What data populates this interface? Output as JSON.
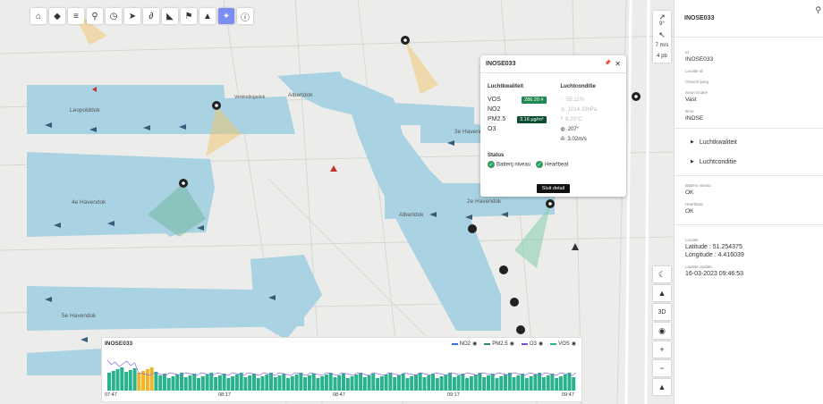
{
  "toolbar": {
    "buttons": [
      {
        "name": "home-icon",
        "glyph": "⌂"
      },
      {
        "name": "layers-icon",
        "glyph": "◆"
      },
      {
        "name": "filter-icon",
        "glyph": "≡"
      },
      {
        "name": "search-icon",
        "glyph": "⚲"
      },
      {
        "name": "clock-icon",
        "glyph": "◷"
      },
      {
        "name": "cursor-icon",
        "glyph": "➤"
      },
      {
        "name": "route-icon",
        "glyph": "∂"
      },
      {
        "name": "tag-icon",
        "glyph": "◣"
      },
      {
        "name": "flag-icon",
        "glyph": "⚑"
      },
      {
        "name": "warning-icon",
        "glyph": "▲"
      },
      {
        "name": "sensor-icon",
        "glyph": "✦",
        "active": true
      },
      {
        "name": "info-icon",
        "glyph": "ⓘ"
      }
    ]
  },
  "wind": {
    "rows": [
      {
        "arrow": "↗",
        "value": "9°"
      },
      {
        "arrow": "↖",
        "value": ""
      },
      {
        "arrow": "",
        "value": "7 m/s"
      },
      {
        "arrow": "",
        "value": "4 pb"
      }
    ]
  },
  "map_controls": [
    {
      "name": "night-mode-icon",
      "glyph": "☾"
    },
    {
      "name": "terrain-icon",
      "glyph": "▲"
    },
    {
      "name": "3d-button",
      "glyph": "3D"
    },
    {
      "name": "locate-icon",
      "glyph": "◉"
    },
    {
      "name": "zoom-in-button",
      "glyph": "+"
    },
    {
      "name": "zoom-out-button",
      "glyph": "−"
    },
    {
      "name": "compass-icon",
      "glyph": "▲"
    }
  ],
  "map_labels": {
    "leopolddok": "Leopolddok",
    "albertdok_top": "Albertdok",
    "havendok_4e": "4e Havendok",
    "albertdok_mid": "Albertdok",
    "havendok_3e": "3e Havendok",
    "havendok_5e": "5e Havendok",
    "havendok_2e": "2e Havendok",
    "verbindingsdok": "Verbindingsdok"
  },
  "popup": {
    "title": "INOSE033",
    "pin_icon": "📌",
    "close_icon": "✕",
    "air_heading": "Luchtkwaliteit",
    "air_rows": [
      {
        "label": "VOS",
        "value": "286.20 #",
        "dark": false
      },
      {
        "label": "NO2",
        "value": "",
        "dark": false
      },
      {
        "label": "PM2.5",
        "value": "3.16 µg/m³",
        "dark": true
      },
      {
        "label": "O3",
        "value": "",
        "dark": false
      }
    ],
    "cond_heading": "Luchtconditie",
    "cond_rows": [
      {
        "icon": "◌",
        "value": "55.11%",
        "faded": true
      },
      {
        "icon": "◎",
        "value": "1014.33hPa",
        "faded": true
      },
      {
        "icon": "⫯",
        "value": "8.20°C",
        "faded": true
      },
      {
        "icon": "◍",
        "value": "207°",
        "faded": false
      },
      {
        "icon": "✇",
        "value": "3.02m/s",
        "faded": false
      }
    ],
    "status_heading": "Status",
    "status_items": [
      "Batterij niveau",
      "Heartbeat"
    ],
    "close_label": "Sluit detail"
  },
  "timeline": {
    "title": "INOSE033",
    "legend": [
      {
        "label": "NO2",
        "color": "#3a6bd8"
      },
      {
        "label": "PM2.5",
        "color": "#2e8b57"
      },
      {
        "label": "O3",
        "color": "#7d4fc4"
      },
      {
        "label": "VOS",
        "color": "#2ab28f"
      }
    ],
    "ticks": [
      "07:47",
      "08:17",
      "08:47",
      "09:17",
      "09:47"
    ]
  },
  "panel": {
    "title": "INOSE033",
    "search_icon": "⚲",
    "fields": [
      {
        "label": "Id",
        "value": "INOSE033"
      },
      {
        "label": "Locatie Id",
        "value": ""
      },
      {
        "label": "Omschrijving",
        "value": ""
      },
      {
        "label": "Soort locatie",
        "value": "Vast"
      },
      {
        "label": "Bron",
        "value": "INOSE"
      }
    ],
    "accordions": [
      "Luchtkwaliteit",
      "Luchtconditie"
    ],
    "status_fields": [
      {
        "label": "Battery niveau",
        "value": "OK"
      },
      {
        "label": "Heartbeat",
        "value": "OK"
      }
    ],
    "location": {
      "label": "Locatie",
      "latitude": "Latitude : 51.254375",
      "longitude": "Longitude : 4.416039",
      "update_label": "Laatste update",
      "update_value": "16-03-2023 09:46:53"
    }
  }
}
